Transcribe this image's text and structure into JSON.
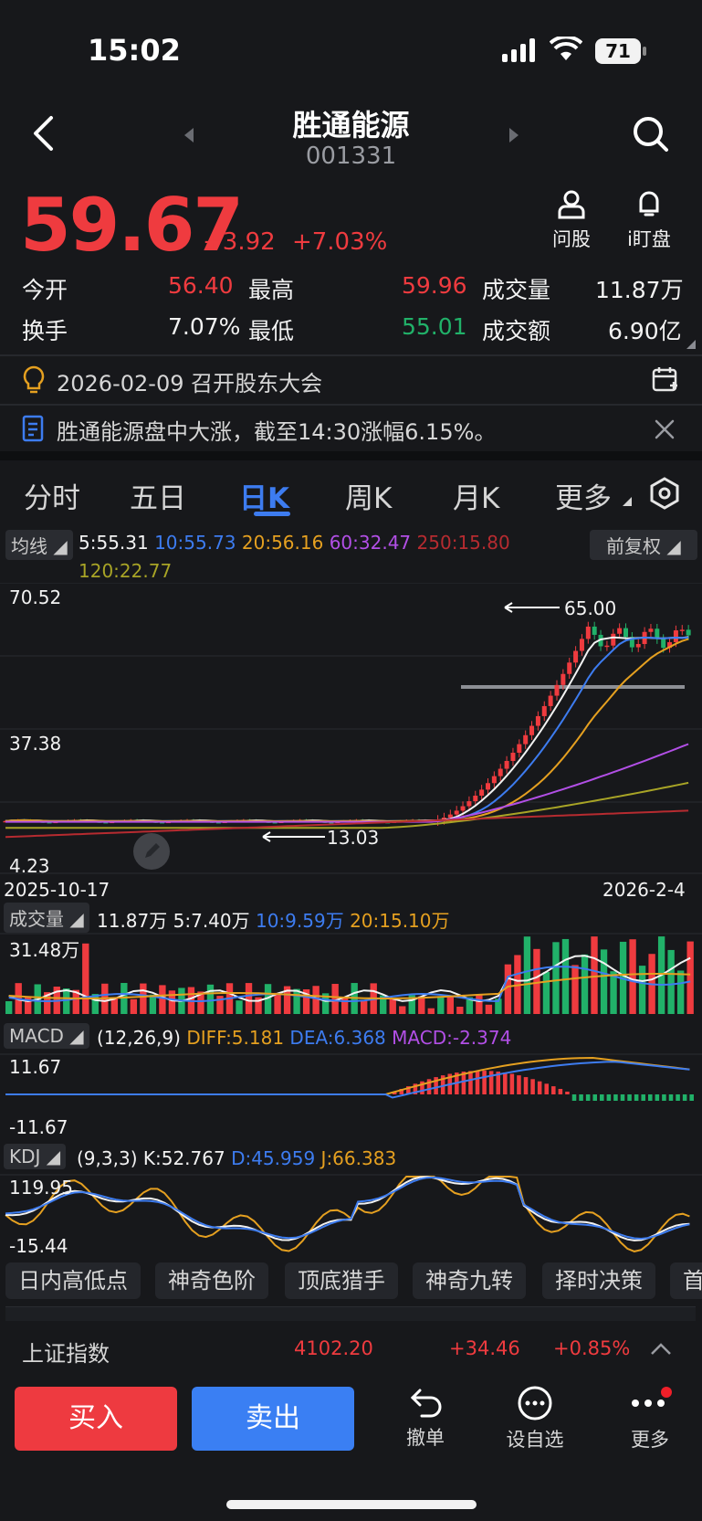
{
  "status": {
    "time": "15:02",
    "battery": "71"
  },
  "header": {
    "name": "胜通能源",
    "code": "001331",
    "ask_label": "问股",
    "watch_label": "i盯盘"
  },
  "quote": {
    "price": "59.67",
    "change": "+3.92",
    "change_pct": "+7.03%",
    "open_label": "今开",
    "open": "56.40",
    "high_label": "最高",
    "high": "59.96",
    "volume_label": "成交量",
    "volume": "11.87万",
    "turnover_label": "换手",
    "turnover": "7.07%",
    "low_label": "最低",
    "low": "55.01",
    "amount_label": "成交额",
    "amount": "6.90亿"
  },
  "notices": {
    "event": "2026-02-09 召开股东大会",
    "news": "胜通能源盘中大涨，截至14:30涨幅6.15%。"
  },
  "tabs": {
    "items": [
      "分时",
      "五日",
      "日K",
      "周K",
      "月K",
      "更多"
    ],
    "active": "日K"
  },
  "ma_bar": {
    "label": "均线",
    "ma5": "5:55.31",
    "ma10": "10:55.73",
    "ma20": "20:56.16",
    "ma60": "60:32.47",
    "ma250": "250:15.80",
    "ma120": "120:22.77",
    "adjust": "前复权"
  },
  "kline": {
    "y_max": "70.52",
    "y_mid": "37.38",
    "y_min": "4.23",
    "high_marker": "65.00",
    "low_marker": "13.03",
    "date_start": "2025-10-17",
    "date_end": "2026-2-4"
  },
  "volume_bar": {
    "label": "成交量",
    "vol": "11.87万",
    "v5": "5:7.40万",
    "v10": "10:9.59万",
    "v20": "20:15.10万",
    "y_max": "31.48万"
  },
  "macd_bar": {
    "label": "MACD",
    "params": "(12,26,9)",
    "diff": "DIFF:5.181",
    "dea": "DEA:6.368",
    "macd": "MACD:-2.374",
    "y_max": "11.67",
    "y_min": "-11.67"
  },
  "kdj_bar": {
    "label": "KDJ",
    "params": "(9,3,3)",
    "k": "K:52.767",
    "d": "D:45.959",
    "j": "J:66.383",
    "y_max": "119.95",
    "y_min": "-15.44"
  },
  "chips": [
    "日内高低点",
    "神奇色阶",
    "顶底猎手",
    "神奇九转",
    "择时决策",
    "首"
  ],
  "index_bar": {
    "name": "上证指数",
    "value": "4102.20",
    "change": "+34.46",
    "pct": "+0.85%"
  },
  "actions": {
    "buy": "买入",
    "sell": "卖出",
    "cancel": "撤单",
    "watchlist": "设自选",
    "more": "更多"
  },
  "colors": {
    "up": "#ef3b3f",
    "down": "#21b169",
    "accent": "#3d7cf0",
    "bg": "#17181b"
  }
}
